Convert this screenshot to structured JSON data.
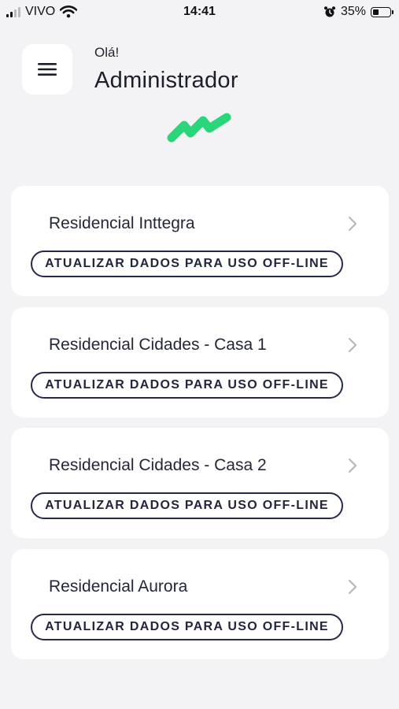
{
  "status_bar": {
    "carrier": "VIVO",
    "time": "14:41",
    "battery_percent": "35%",
    "battery_level": 0.35,
    "icons": [
      "signal-icon",
      "wifi-icon",
      "alarm-icon",
      "battery-icon"
    ]
  },
  "header": {
    "menu_icon": "hamburger-menu-icon",
    "greeting": "Olá!",
    "user_name": "Administrador",
    "logo": "green-wave-logo"
  },
  "properties": [
    {
      "name": "Residencial Inttegra",
      "action_label": "ATUALIZAR DADOS PARA USO OFF-LINE"
    },
    {
      "name": "Residencial Cidades - Casa 1",
      "action_label": "ATUALIZAR DADOS PARA USO OFF-LINE"
    },
    {
      "name": "Residencial Cidades - Casa 2",
      "action_label": "ATUALIZAR DADOS PARA USO OFF-LINE"
    },
    {
      "name": "Residencial Aurora",
      "action_label": "ATUALIZAR DADOS PARA USO OFF-LINE"
    }
  ],
  "colors": {
    "background": "#f3f3f6",
    "card": "#ffffff",
    "accent_green": "#2bd67b",
    "button_border": "#262a4a",
    "text_primary": "#1c1e2c",
    "chevron": "#b4b4ba"
  }
}
